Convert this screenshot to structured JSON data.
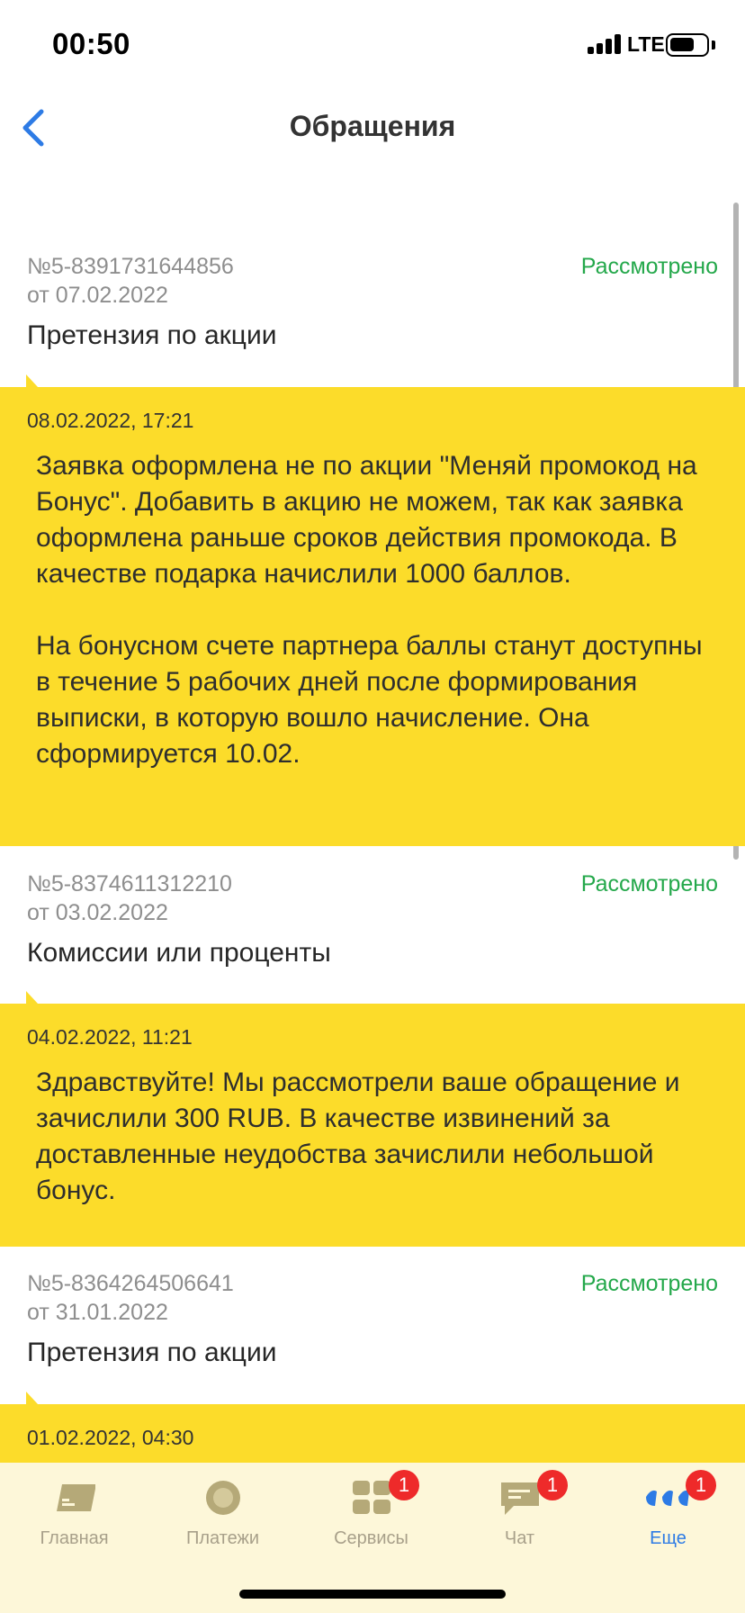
{
  "status_bar": {
    "time": "00:50",
    "network": "LTE",
    "battery_level": 0.6
  },
  "nav": {
    "title": "Обращения",
    "back_icon": "chevron-left-icon",
    "accent_color": "#2d7be5"
  },
  "tickets": [
    {
      "number": "№5-8391731644856",
      "date": "от 07.02.2022",
      "status": "Рассмотрено",
      "subject": "Претензия по акции",
      "reply": {
        "time": "08.02.2022, 17:21",
        "text": "Заявка оформлена не по акции \"Меняй промокод на Бонус\". Добавить в акцию не можем, так как заявка оформлена раньше сроков действия промокода. В качестве подарка начислили 1000 баллов.\n\nНа бонусном счете партнера баллы станут доступны в течение 5 рабочих дней после формирования выписки, в которую вошло начисление. Она сформируется 10.02."
      }
    },
    {
      "number": "№5-8374611312210",
      "date": "от 03.02.2022",
      "status": "Рассмотрено",
      "subject": "Комиссии или проценты",
      "reply": {
        "time": "04.02.2022, 11:21",
        "text": "Здравствуйте! Мы рассмотрели ваше обращение и зачислили 300 RUB. В качестве извинений за доставленные неудобства зачислили небольшой бонус."
      }
    },
    {
      "number": "№5-8364264506641",
      "date": "от 31.01.2022",
      "status": "Рассмотрено",
      "subject": "Претензия по акции",
      "reply": {
        "time": "01.02.2022, 04:30",
        "text": ""
      }
    }
  ],
  "tab_bar": {
    "tabs": [
      {
        "label": "Главная",
        "icon": "card-icon",
        "badge": ""
      },
      {
        "label": "Платежи",
        "icon": "payments-icon",
        "badge": ""
      },
      {
        "label": "Сервисы",
        "icon": "services-grid-icon",
        "badge": "1"
      },
      {
        "label": "Чат",
        "icon": "chat-icon",
        "badge": "1"
      },
      {
        "label": "Еще",
        "icon": "more-dots-icon",
        "badge": "1"
      }
    ],
    "active_index": 4
  },
  "colors": {
    "status_green": "#24a84b",
    "reply_yellow": "#fcdc2a",
    "badge_red": "#ee2a2a"
  }
}
